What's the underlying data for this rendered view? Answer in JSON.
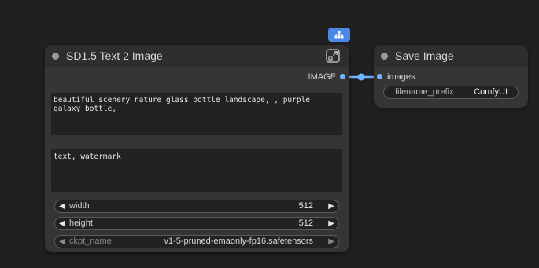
{
  "node_text2image": {
    "title": "SD1.5 Text 2 Image",
    "output_label": "IMAGE",
    "positive_prompt": "beautiful scenery nature glass bottle landscape, , purple galaxy bottle,",
    "negative_prompt": "text, watermark",
    "widgets": {
      "width": {
        "label": "width",
        "value": "512"
      },
      "height": {
        "label": "height",
        "value": "512"
      },
      "ckpt_name": {
        "label": "ckpt_name",
        "value": "v1-5-pruned-emaonly-fp16.safetensors"
      }
    }
  },
  "node_save_image": {
    "title": "Save Image",
    "input_label": "images",
    "widgets": {
      "filename_prefix": {
        "label": "filename_prefix",
        "value": "ComfyUI"
      }
    }
  },
  "colors": {
    "canvas": "#202020",
    "node_body": "#353535",
    "accent": "#4a8ae6",
    "link": "#6fb5ff"
  },
  "icons": {
    "badge": "subgraph-icon",
    "expand": "expand-icon",
    "left_arrow": "arrow-left-icon",
    "right_arrow": "arrow-right-icon"
  }
}
